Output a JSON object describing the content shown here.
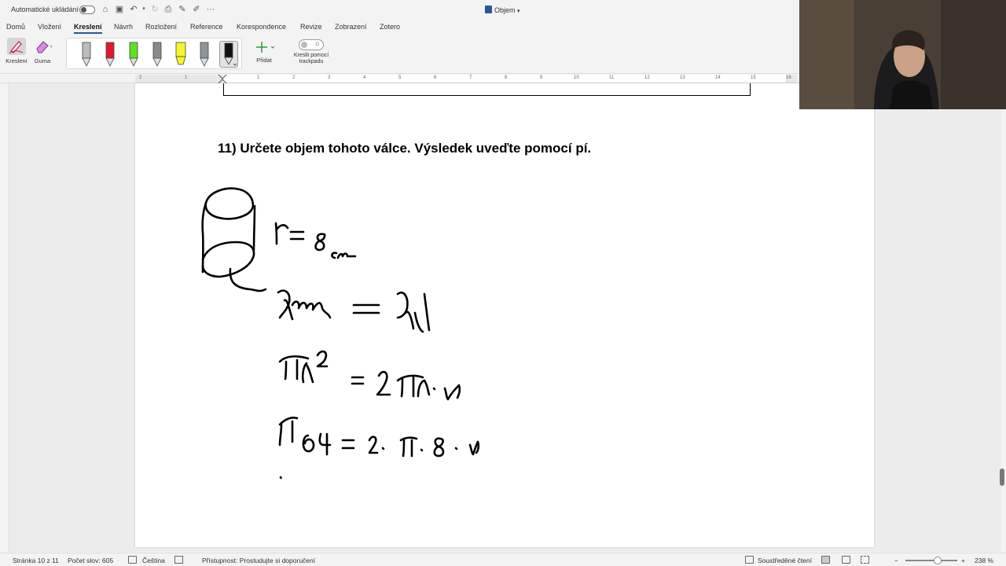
{
  "titlebar": {
    "autosave_label": "Automatické ukládání",
    "doc_title": "Objem"
  },
  "tabs": [
    "Domů",
    "Vložení",
    "Kreslení",
    "Návrh",
    "Rozložení",
    "Reference",
    "Korespondence",
    "Revize",
    "Zobrazení",
    "Zotero"
  ],
  "active_tab": "Kreslení",
  "ribbon": {
    "draw_label": "Kreslení",
    "eraser_label": "Guma",
    "add_label": "Přidat",
    "trackpad_label_1": "Kreslit pomocí",
    "trackpad_label_2": "trackpadu",
    "trackpad_toggle_state": "O",
    "pens": [
      {
        "name": "pen-gray",
        "color": "#bdbdbd"
      },
      {
        "name": "pen-red",
        "color": "#e0182d"
      },
      {
        "name": "pen-green",
        "color": "#5ee11f"
      },
      {
        "name": "pen-dark-gray",
        "color": "#8b8b8b"
      },
      {
        "name": "highlighter-yellow",
        "color": "#f5f52a"
      },
      {
        "name": "pen-gray-2",
        "color": "#8e9499"
      },
      {
        "name": "pen-black",
        "color": "#111111"
      }
    ]
  },
  "ruler_numbers": [
    "2",
    "1",
    "1",
    "2",
    "3",
    "4",
    "5",
    "6",
    "7",
    "8",
    "9",
    "10",
    "11",
    "12",
    "13",
    "14",
    "15",
    "16"
  ],
  "document": {
    "question": "11) Určete objem tohoto válce. Výsledek uveďte pomocí pí."
  },
  "status": {
    "page": "Stránka 10 z 11",
    "words": "Počet slov: 605",
    "language": "Čeština",
    "accessibility": "Přístupnost: Prostudujte si doporučení",
    "focus": "Soustředěné čtení",
    "zoom_minus": "−",
    "zoom_plus": "+",
    "zoom": "238 %"
  },
  "colors": {
    "accent": "#2b579a",
    "ink": "#000000"
  }
}
